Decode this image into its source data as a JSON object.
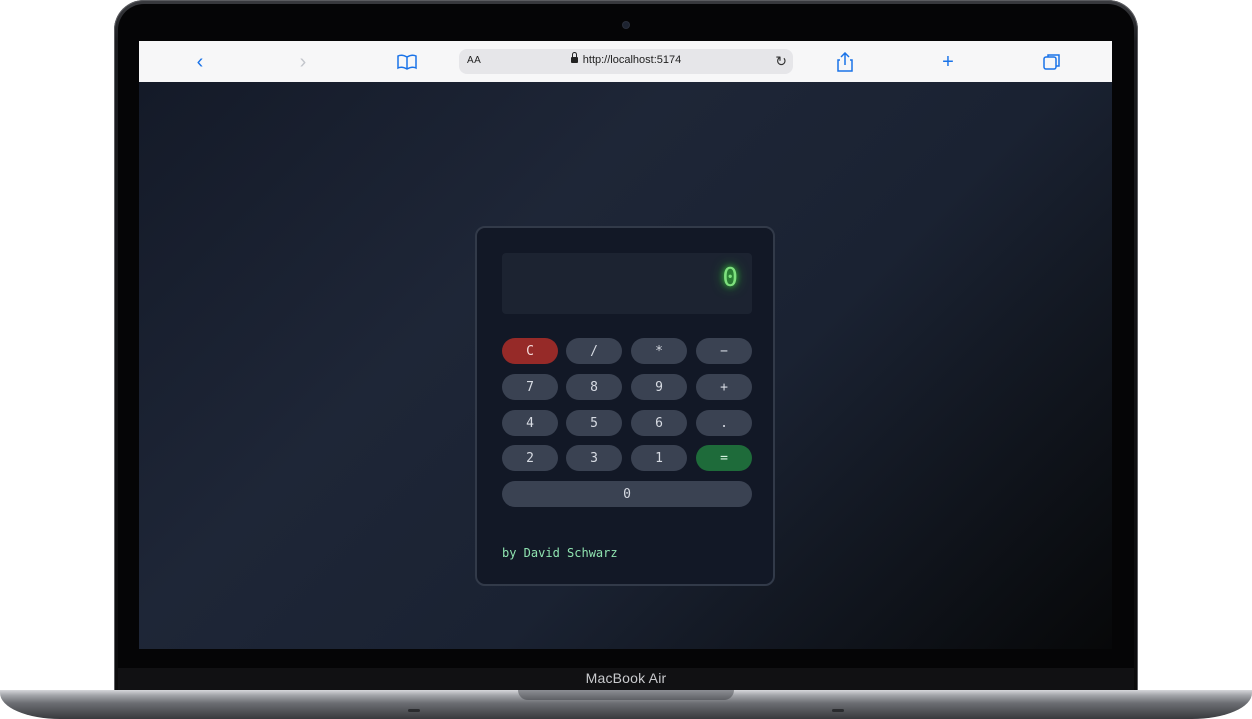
{
  "device": {
    "brand_label": "MacBook Air"
  },
  "browser": {
    "text_size_label": "AA",
    "url": "http://localhost:5174",
    "back_icon": "chevron-left-icon",
    "forward_icon": "chevron-right-icon",
    "bookmarks_icon": "book-icon",
    "reload_icon": "reload-icon",
    "share_icon": "share-icon",
    "new_tab_icon": "plus-icon",
    "tabs_icon": "tabs-icon"
  },
  "calculator": {
    "display": "0",
    "keys": {
      "clear": "C",
      "divide": "/",
      "multiply": "*",
      "minus": "−",
      "k7": "7",
      "k8": "8",
      "k9": "9",
      "plus": "+",
      "k4": "4",
      "k5": "5",
      "k6": "6",
      "dot": ".",
      "k2": "2",
      "k3": "3",
      "k1": "1",
      "equals": "=",
      "k0": "0"
    },
    "credit": "by David Schwarz",
    "colors": {
      "clear": "#962a28",
      "equals": "#1e6b3a",
      "display_text": "#7ee07e",
      "key": "#3a4252"
    }
  }
}
